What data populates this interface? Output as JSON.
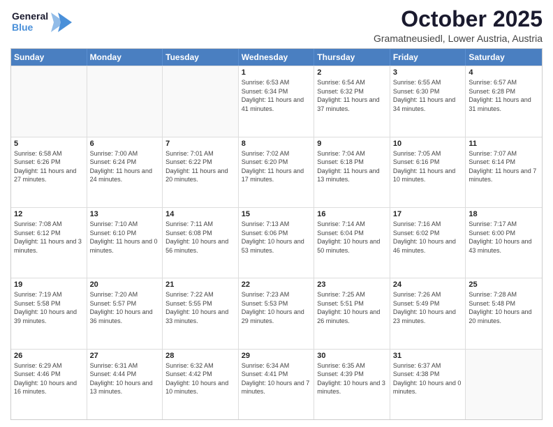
{
  "logo": {
    "line1": "General",
    "line2": "Blue",
    "arrow_color": "#4a90d9"
  },
  "title": "October 2025",
  "subtitle": "Gramatneusiedl, Lower Austria, Austria",
  "header_days": [
    "Sunday",
    "Monday",
    "Tuesday",
    "Wednesday",
    "Thursday",
    "Friday",
    "Saturday"
  ],
  "weeks": [
    [
      {
        "day": "",
        "sunrise": "",
        "sunset": "",
        "daylight": ""
      },
      {
        "day": "",
        "sunrise": "",
        "sunset": "",
        "daylight": ""
      },
      {
        "day": "",
        "sunrise": "",
        "sunset": "",
        "daylight": ""
      },
      {
        "day": "1",
        "sunrise": "Sunrise: 6:53 AM",
        "sunset": "Sunset: 6:34 PM",
        "daylight": "Daylight: 11 hours and 41 minutes."
      },
      {
        "day": "2",
        "sunrise": "Sunrise: 6:54 AM",
        "sunset": "Sunset: 6:32 PM",
        "daylight": "Daylight: 11 hours and 37 minutes."
      },
      {
        "day": "3",
        "sunrise": "Sunrise: 6:55 AM",
        "sunset": "Sunset: 6:30 PM",
        "daylight": "Daylight: 11 hours and 34 minutes."
      },
      {
        "day": "4",
        "sunrise": "Sunrise: 6:57 AM",
        "sunset": "Sunset: 6:28 PM",
        "daylight": "Daylight: 11 hours and 31 minutes."
      }
    ],
    [
      {
        "day": "5",
        "sunrise": "Sunrise: 6:58 AM",
        "sunset": "Sunset: 6:26 PM",
        "daylight": "Daylight: 11 hours and 27 minutes."
      },
      {
        "day": "6",
        "sunrise": "Sunrise: 7:00 AM",
        "sunset": "Sunset: 6:24 PM",
        "daylight": "Daylight: 11 hours and 24 minutes."
      },
      {
        "day": "7",
        "sunrise": "Sunrise: 7:01 AM",
        "sunset": "Sunset: 6:22 PM",
        "daylight": "Daylight: 11 hours and 20 minutes."
      },
      {
        "day": "8",
        "sunrise": "Sunrise: 7:02 AM",
        "sunset": "Sunset: 6:20 PM",
        "daylight": "Daylight: 11 hours and 17 minutes."
      },
      {
        "day": "9",
        "sunrise": "Sunrise: 7:04 AM",
        "sunset": "Sunset: 6:18 PM",
        "daylight": "Daylight: 11 hours and 13 minutes."
      },
      {
        "day": "10",
        "sunrise": "Sunrise: 7:05 AM",
        "sunset": "Sunset: 6:16 PM",
        "daylight": "Daylight: 11 hours and 10 minutes."
      },
      {
        "day": "11",
        "sunrise": "Sunrise: 7:07 AM",
        "sunset": "Sunset: 6:14 PM",
        "daylight": "Daylight: 11 hours and 7 minutes."
      }
    ],
    [
      {
        "day": "12",
        "sunrise": "Sunrise: 7:08 AM",
        "sunset": "Sunset: 6:12 PM",
        "daylight": "Daylight: 11 hours and 3 minutes."
      },
      {
        "day": "13",
        "sunrise": "Sunrise: 7:10 AM",
        "sunset": "Sunset: 6:10 PM",
        "daylight": "Daylight: 11 hours and 0 minutes."
      },
      {
        "day": "14",
        "sunrise": "Sunrise: 7:11 AM",
        "sunset": "Sunset: 6:08 PM",
        "daylight": "Daylight: 10 hours and 56 minutes."
      },
      {
        "day": "15",
        "sunrise": "Sunrise: 7:13 AM",
        "sunset": "Sunset: 6:06 PM",
        "daylight": "Daylight: 10 hours and 53 minutes."
      },
      {
        "day": "16",
        "sunrise": "Sunrise: 7:14 AM",
        "sunset": "Sunset: 6:04 PM",
        "daylight": "Daylight: 10 hours and 50 minutes."
      },
      {
        "day": "17",
        "sunrise": "Sunrise: 7:16 AM",
        "sunset": "Sunset: 6:02 PM",
        "daylight": "Daylight: 10 hours and 46 minutes."
      },
      {
        "day": "18",
        "sunrise": "Sunrise: 7:17 AM",
        "sunset": "Sunset: 6:00 PM",
        "daylight": "Daylight: 10 hours and 43 minutes."
      }
    ],
    [
      {
        "day": "19",
        "sunrise": "Sunrise: 7:19 AM",
        "sunset": "Sunset: 5:58 PM",
        "daylight": "Daylight: 10 hours and 39 minutes."
      },
      {
        "day": "20",
        "sunrise": "Sunrise: 7:20 AM",
        "sunset": "Sunset: 5:57 PM",
        "daylight": "Daylight: 10 hours and 36 minutes."
      },
      {
        "day": "21",
        "sunrise": "Sunrise: 7:22 AM",
        "sunset": "Sunset: 5:55 PM",
        "daylight": "Daylight: 10 hours and 33 minutes."
      },
      {
        "day": "22",
        "sunrise": "Sunrise: 7:23 AM",
        "sunset": "Sunset: 5:53 PM",
        "daylight": "Daylight: 10 hours and 29 minutes."
      },
      {
        "day": "23",
        "sunrise": "Sunrise: 7:25 AM",
        "sunset": "Sunset: 5:51 PM",
        "daylight": "Daylight: 10 hours and 26 minutes."
      },
      {
        "day": "24",
        "sunrise": "Sunrise: 7:26 AM",
        "sunset": "Sunset: 5:49 PM",
        "daylight": "Daylight: 10 hours and 23 minutes."
      },
      {
        "day": "25",
        "sunrise": "Sunrise: 7:28 AM",
        "sunset": "Sunset: 5:48 PM",
        "daylight": "Daylight: 10 hours and 20 minutes."
      }
    ],
    [
      {
        "day": "26",
        "sunrise": "Sunrise: 6:29 AM",
        "sunset": "Sunset: 4:46 PM",
        "daylight": "Daylight: 10 hours and 16 minutes."
      },
      {
        "day": "27",
        "sunrise": "Sunrise: 6:31 AM",
        "sunset": "Sunset: 4:44 PM",
        "daylight": "Daylight: 10 hours and 13 minutes."
      },
      {
        "day": "28",
        "sunrise": "Sunrise: 6:32 AM",
        "sunset": "Sunset: 4:42 PM",
        "daylight": "Daylight: 10 hours and 10 minutes."
      },
      {
        "day": "29",
        "sunrise": "Sunrise: 6:34 AM",
        "sunset": "Sunset: 4:41 PM",
        "daylight": "Daylight: 10 hours and 7 minutes."
      },
      {
        "day": "30",
        "sunrise": "Sunrise: 6:35 AM",
        "sunset": "Sunset: 4:39 PM",
        "daylight": "Daylight: 10 hours and 3 minutes."
      },
      {
        "day": "31",
        "sunrise": "Sunrise: 6:37 AM",
        "sunset": "Sunset: 4:38 PM",
        "daylight": "Daylight: 10 hours and 0 minutes."
      },
      {
        "day": "",
        "sunrise": "",
        "sunset": "",
        "daylight": ""
      }
    ]
  ]
}
